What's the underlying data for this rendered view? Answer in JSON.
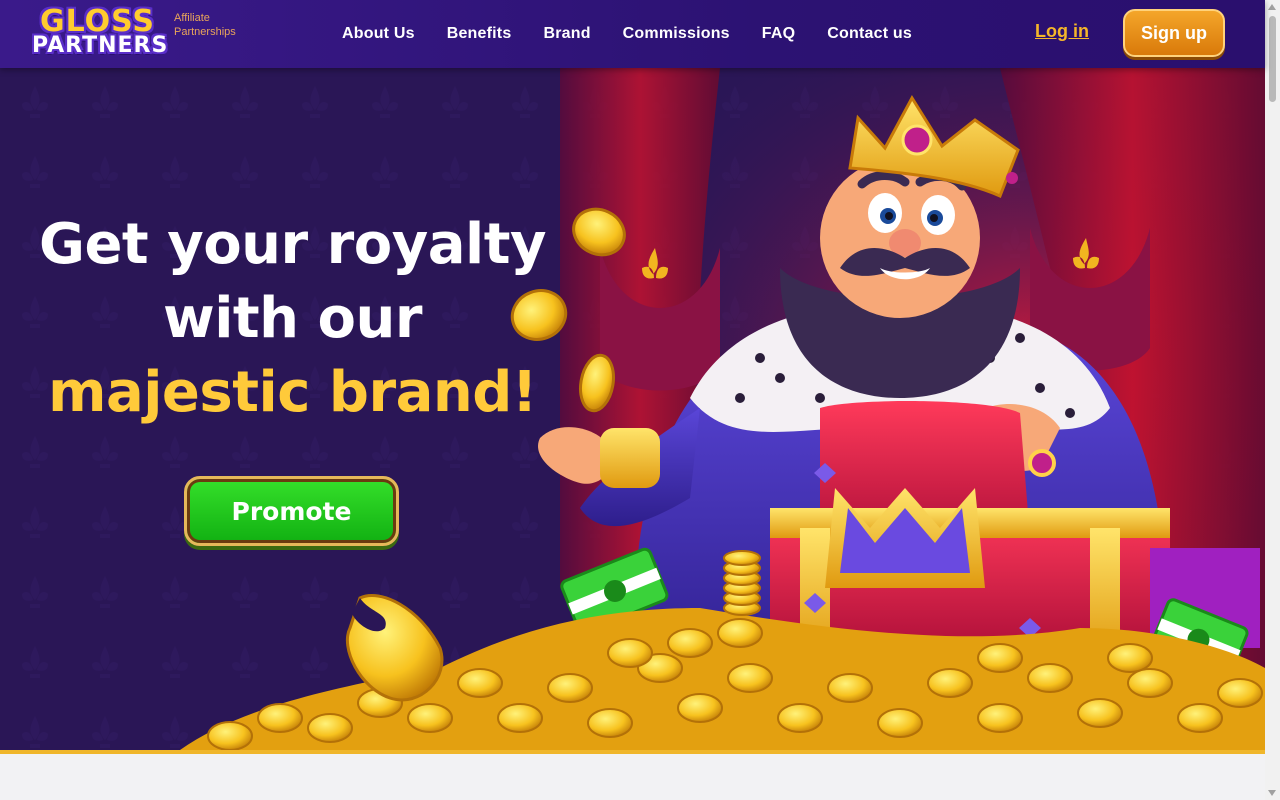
{
  "brand": {
    "logo_top": "GLOSS",
    "logo_bottom": "PARTNERS",
    "tagline_line1": "Affiliate",
    "tagline_line2": "Partnerships"
  },
  "nav": {
    "items": [
      {
        "label": "About Us"
      },
      {
        "label": "Benefits"
      },
      {
        "label": "Brand"
      },
      {
        "label": "Commissions"
      },
      {
        "label": "FAQ"
      },
      {
        "label": "Contact us"
      }
    ]
  },
  "auth": {
    "login_label": "Log in",
    "signup_label": "Sign up"
  },
  "hero": {
    "line1": "Get your royalty",
    "line2": "with our",
    "line3": "majestic brand!",
    "cta_label": "Promote"
  },
  "colors": {
    "header_bg": "#2c1273",
    "accent_gold": "#ffca3a",
    "cta_green": "#22c81c",
    "signup_orange": "#e8901a"
  },
  "icons": [
    "crown-icon",
    "coin-icon",
    "cash-stack-icon",
    "gem-icon"
  ]
}
